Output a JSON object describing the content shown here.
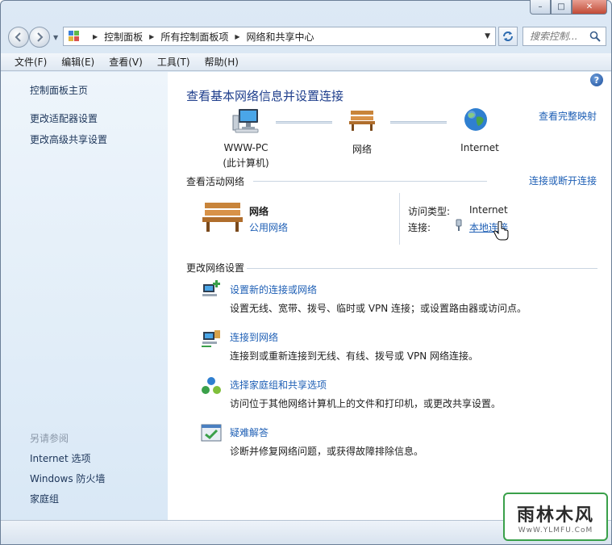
{
  "window": {
    "minimize_glyph": "–",
    "maximize_glyph": "□",
    "close_glyph": "✕"
  },
  "address": {
    "breadcrumbs": [
      "控制面板",
      "所有控制面板项",
      "网络和共享中心"
    ],
    "search_placeholder": "搜索控制..."
  },
  "menu": {
    "items": [
      "文件(F)",
      "编辑(E)",
      "查看(V)",
      "工具(T)",
      "帮助(H)"
    ]
  },
  "sidebar": {
    "home": "控制面板主页",
    "adapter_settings": "更改适配器设置",
    "advanced_sharing": "更改高级共享设置",
    "see_also_title": "另请参阅",
    "see_also": [
      "Internet 选项",
      "Windows 防火墙",
      "家庭组"
    ]
  },
  "main": {
    "title": "查看基本网络信息并设置连接",
    "full_map_link": "查看完整映射",
    "map": {
      "computer_name": "WWW-PC",
      "computer_sub": "(此计算机)",
      "network": "网络",
      "internet": "Internet"
    },
    "active_section": {
      "title": "查看活动网络",
      "connect_link": "连接或断开连接",
      "network_name": "网络",
      "network_type": "公用网络",
      "access_type_label": "访问类型:",
      "access_type_value": "Internet",
      "connections_label": "连接:",
      "connections_value": "本地连接"
    },
    "settings_section": {
      "title": "更改网络设置",
      "tasks": [
        {
          "link": "设置新的连接或网络",
          "desc": "设置无线、宽带、拨号、临时或 VPN 连接；或设置路由器或访问点。"
        },
        {
          "link": "连接到网络",
          "desc": "连接到或重新连接到无线、有线、拨号或 VPN 网络连接。"
        },
        {
          "link": "选择家庭组和共享选项",
          "desc": "访问位于其他网络计算机上的文件和打印机，或更改共享设置。"
        },
        {
          "link": "疑难解答",
          "desc": "诊断并修复网络问题，或获得故障排除信息。"
        }
      ]
    }
  },
  "watermark": {
    "top": "雨林木风",
    "bottom": "WwW.YLMFU.CoM"
  },
  "colors": {
    "link": "#1e5fb5",
    "title": "#1e3e8c",
    "sidebar_bg": "#e4eef8"
  }
}
